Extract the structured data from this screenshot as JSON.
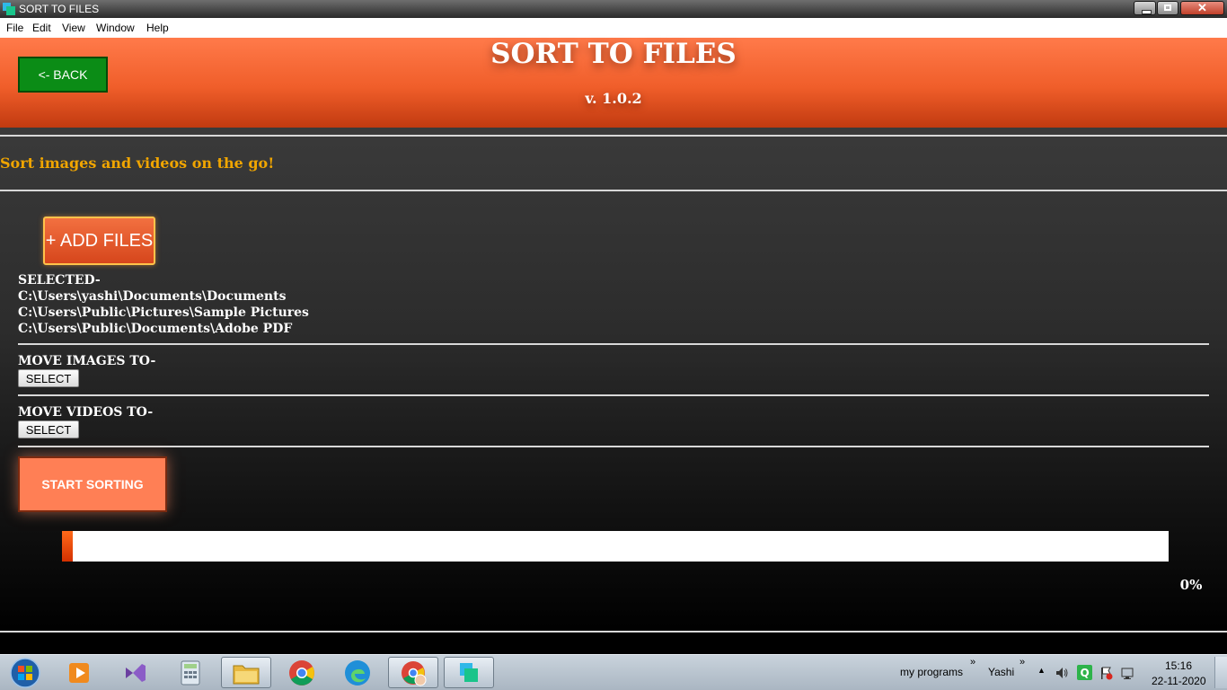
{
  "window": {
    "title": "SORT TO FILES"
  },
  "menu": [
    "File",
    "Edit",
    "View",
    "Window",
    "Help"
  ],
  "header": {
    "back_label": "<- BACK",
    "app_title": "SORT TO FILES",
    "version": "v. 1.0.2"
  },
  "tagline": "Sort images and videos on the go!",
  "add_files_label": "+ ADD FILES",
  "selected": {
    "label": "SELECTED-",
    "paths": [
      "C:\\Users\\yashi\\Documents\\Documents",
      "C:\\Users\\Public\\Pictures\\Sample Pictures",
      "C:\\Users\\Public\\Documents\\Adobe PDF"
    ]
  },
  "move_images": {
    "label": "MOVE IMAGES TO-",
    "button": "SELECT"
  },
  "move_videos": {
    "label": "MOVE VIDEOS TO-",
    "button": "SELECT"
  },
  "start_label": "START SORTING",
  "progress": {
    "value": 0.01,
    "label": "0%"
  },
  "taskbar": {
    "tray_label_1": "my programs",
    "tray_label_2": "Yashi",
    "time": "15:16",
    "date": "22-11-2020"
  },
  "colors": {
    "header_orange": "#f05e2a",
    "back_green": "#0b8c16",
    "tagline": "#f0a500",
    "start": "#ff7f55"
  }
}
